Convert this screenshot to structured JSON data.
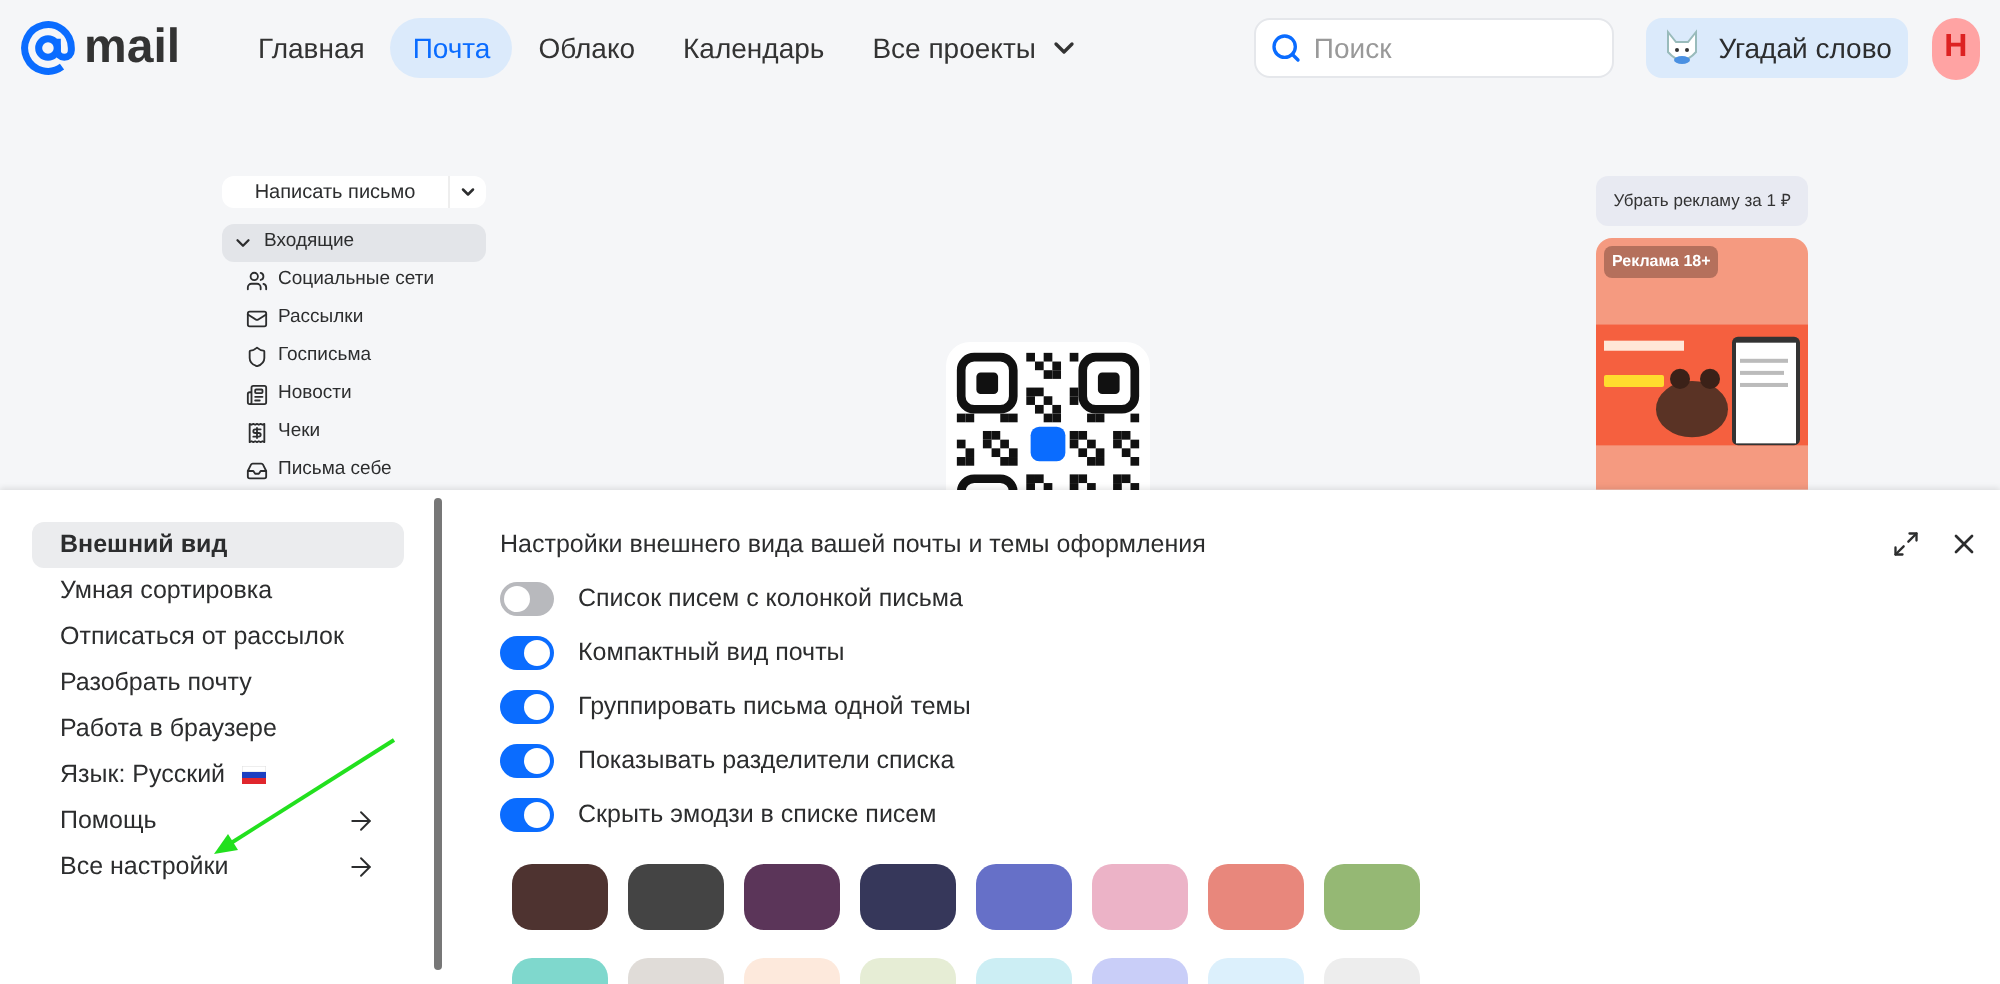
{
  "header": {
    "logo_text": "mail",
    "nav": [
      {
        "label": "Главная",
        "selected": false
      },
      {
        "label": "Почта",
        "selected": true
      },
      {
        "label": "Облако",
        "selected": false
      },
      {
        "label": "Календарь",
        "selected": false
      },
      {
        "label": "Все проекты",
        "selected": false,
        "kind": "dropdown"
      }
    ],
    "search": {
      "placeholder": "Поиск"
    },
    "game_button": "Угадай слово",
    "avatar": "Н"
  },
  "mail_sidebar": {
    "compose": "Написать письмо",
    "folders": [
      {
        "label": "Входящие",
        "selected": true,
        "kind": "parent"
      },
      {
        "label": "Социальные сети",
        "selected": false,
        "kind": "social"
      },
      {
        "label": "Рассылки",
        "selected": false,
        "kind": "newsletters"
      },
      {
        "label": "Госписьма",
        "selected": false,
        "kind": "gov"
      },
      {
        "label": "Новости",
        "selected": false,
        "kind": "news"
      },
      {
        "label": "Чеки",
        "selected": false,
        "kind": "receipts"
      },
      {
        "label": "Письма себе",
        "selected": false,
        "kind": "self"
      }
    ]
  },
  "ads": {
    "remove_button": "Убрать рекламу за 1 ₽",
    "badge": "Реклама 18+"
  },
  "settings": {
    "nav": [
      {
        "label": "Внешний вид",
        "selected": true
      },
      {
        "label": "Умная сортировка",
        "selected": false
      },
      {
        "label": "Отписаться от рассылок",
        "selected": false
      },
      {
        "label": "Разобрать почту",
        "selected": false
      },
      {
        "label": "Работа в браузере",
        "selected": false
      },
      {
        "label": "Язык: Русский",
        "selected": false,
        "kind": "language"
      },
      {
        "label": "Помощь",
        "selected": false,
        "kind": "link"
      },
      {
        "label": "Все настройки",
        "selected": false,
        "kind": "link"
      }
    ],
    "title": "Настройки внешнего вида вашей почты и темы оформления",
    "toggles": [
      {
        "label": "Список писем с колонкой письма",
        "on": false
      },
      {
        "label": "Компактный вид почты",
        "on": true
      },
      {
        "label": "Группировать письма одной темы",
        "on": true
      },
      {
        "label": "Показывать разделители списка",
        "on": true
      },
      {
        "label": "Скрыть эмодзи в списке писем",
        "on": true
      }
    ],
    "themes": [
      {
        "color": "#4e3330"
      },
      {
        "color": "#444444"
      },
      {
        "color": "#5b3559"
      },
      {
        "color": "#36375a"
      },
      {
        "color": "#6670c8"
      },
      {
        "color": "#ecb3c7"
      },
      {
        "color": "#e8877c"
      },
      {
        "color": "#95b874"
      },
      {
        "color": "#7fd8cd"
      },
      {
        "color": "#e0dcd8"
      },
      {
        "color": "#fde9dc"
      },
      {
        "color": "#e6edd5"
      },
      {
        "color": "#cceef4"
      },
      {
        "color": "#c9cef8"
      },
      {
        "color": "#dcf0fc"
      },
      {
        "color": "#ededed"
      }
    ]
  }
}
